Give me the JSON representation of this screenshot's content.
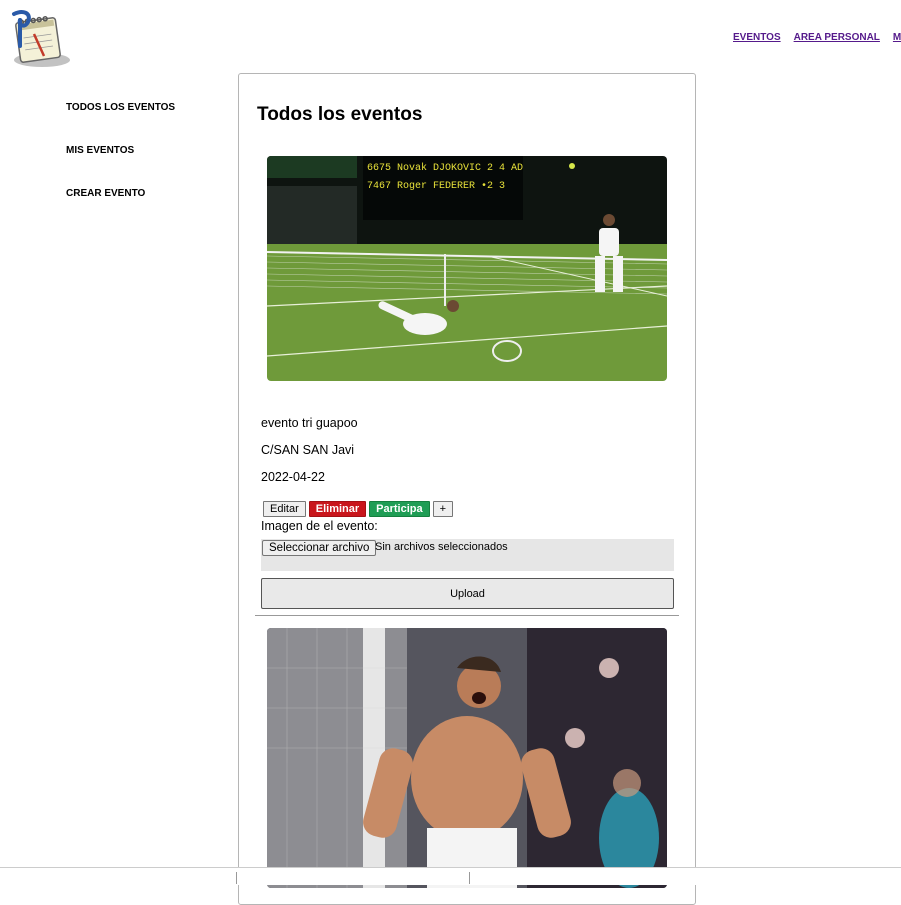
{
  "header": {
    "logo_icon": "calendar-notepad-logo-icon",
    "nav": [
      {
        "label": "EVENTOS"
      },
      {
        "label": "AREA PERSONAL"
      },
      {
        "label": "M"
      }
    ]
  },
  "sidebar": {
    "items": [
      {
        "label": "TODOS LOS EVENTOS"
      },
      {
        "label": "MIS EVENTOS"
      },
      {
        "label": "CREAR EVENTO"
      }
    ]
  },
  "main": {
    "title": "Todos los eventos",
    "events": [
      {
        "name": "evento tri guapoo",
        "address": "C/SAN SAN Javi",
        "date": "2022-04-22",
        "buttons": {
          "edit": "Editar",
          "delete": "Eliminar",
          "join": "Participa",
          "more": "+"
        },
        "image_label": "Imagen de el evento:",
        "file_button": "Seleccionar archivo",
        "file_status": "Sin archivos seleccionados",
        "upload": "Upload"
      }
    ]
  },
  "colors": {
    "link": "#551a8b",
    "delete": "#c9161c",
    "join": "#1f9d55"
  }
}
